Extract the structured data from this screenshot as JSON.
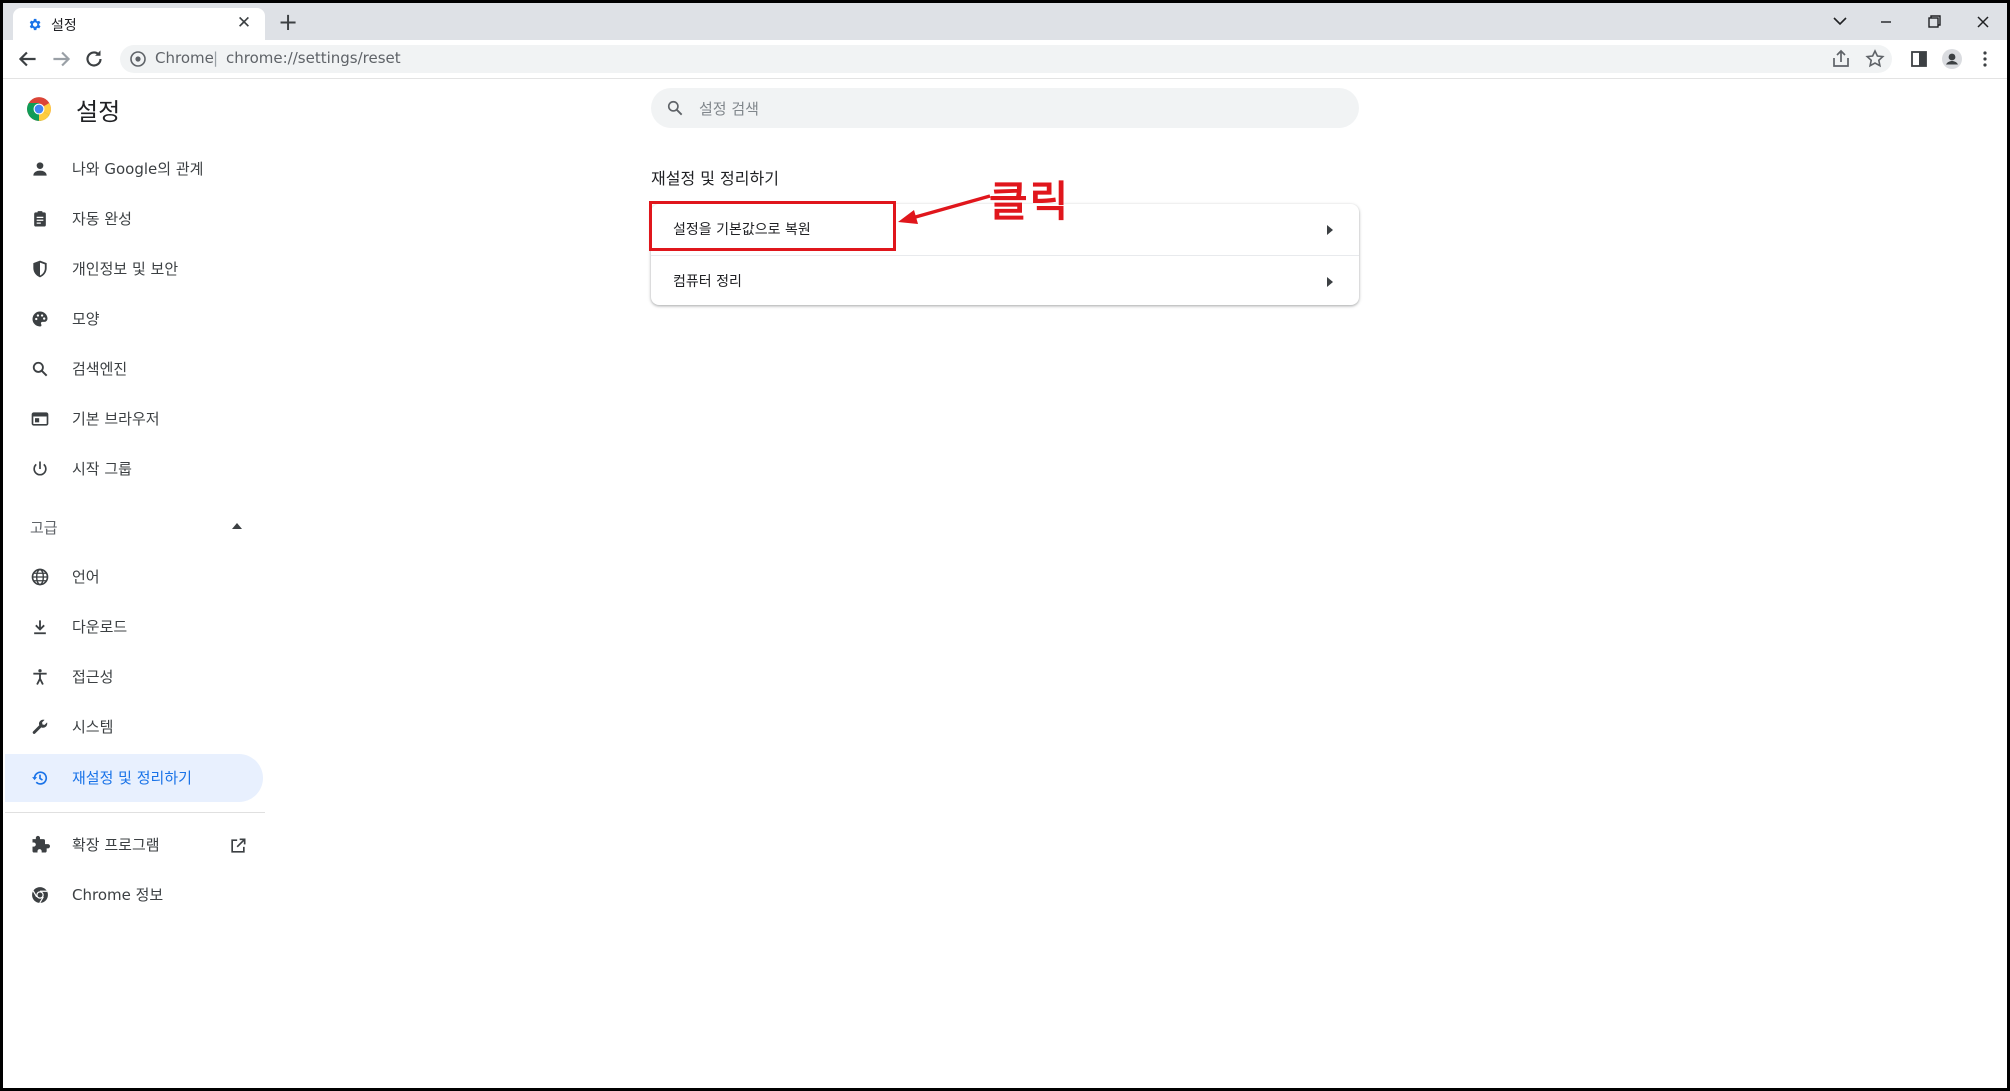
{
  "browser": {
    "tab_title": "설정",
    "omnibox_chip": "Chrome",
    "omnibox_sep": "|",
    "url": "chrome://settings/reset"
  },
  "sidebar": {
    "title": "설정",
    "items": [
      {
        "label": "나와 Google의 관계",
        "icon": "person-icon"
      },
      {
        "label": "자동 완성",
        "icon": "clipboard-icon"
      },
      {
        "label": "개인정보 및 보안",
        "icon": "shield-icon"
      },
      {
        "label": "모양",
        "icon": "palette-icon"
      },
      {
        "label": "검색엔진",
        "icon": "search-icon"
      },
      {
        "label": "기본 브라우저",
        "icon": "browser-window-icon"
      },
      {
        "label": "시작 그룹",
        "icon": "power-icon"
      }
    ],
    "advanced_label": "고급",
    "advanced_items": [
      {
        "label": "언어",
        "icon": "globe-icon"
      },
      {
        "label": "다운로드",
        "icon": "download-icon"
      },
      {
        "label": "접근성",
        "icon": "accessibility-icon"
      },
      {
        "label": "시스템",
        "icon": "wrench-icon"
      },
      {
        "label": "재설정 및 정리하기",
        "icon": "restore-icon"
      }
    ],
    "extensions_label": "확장 프로그램",
    "about_label": "Chrome 정보"
  },
  "main": {
    "search_placeholder": "설정 검색",
    "section_title": "재설정 및 정리하기",
    "rows": [
      {
        "label": "설정을 기본값으로 복원"
      },
      {
        "label": "컴퓨터 정리"
      }
    ]
  },
  "annotation": {
    "text": "클릭",
    "color": "#e0161c"
  },
  "colors": {
    "accent": "#1a73e8",
    "active_bg": "#e8f0fe"
  }
}
